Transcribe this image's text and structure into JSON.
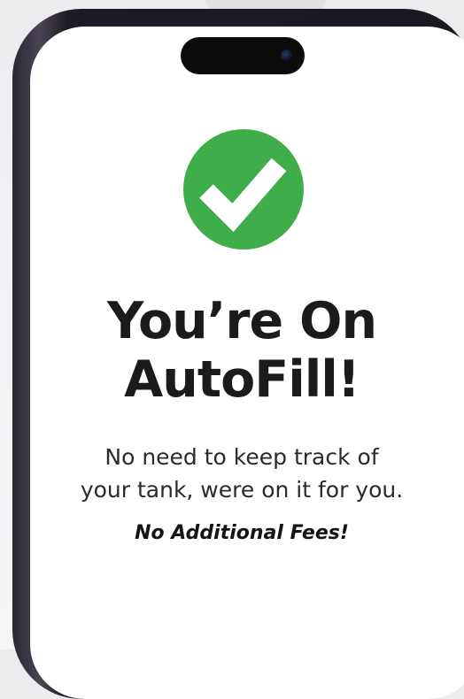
{
  "confirmation": {
    "headline_line1": "You’re On",
    "headline_line2": "AutoFill!",
    "body_line1": "No need to keep track of",
    "body_line2": "your tank, were on it for you.",
    "fee_note": "No Additional Fees!"
  },
  "icons": {
    "status": "checkmark-circle-icon",
    "camera": "front-camera-icon"
  },
  "colors": {
    "success_green": "#3fae4a",
    "text_primary": "#1b1b1b",
    "screen_background": "#ffffff",
    "device_frame": "#1e1b24"
  }
}
